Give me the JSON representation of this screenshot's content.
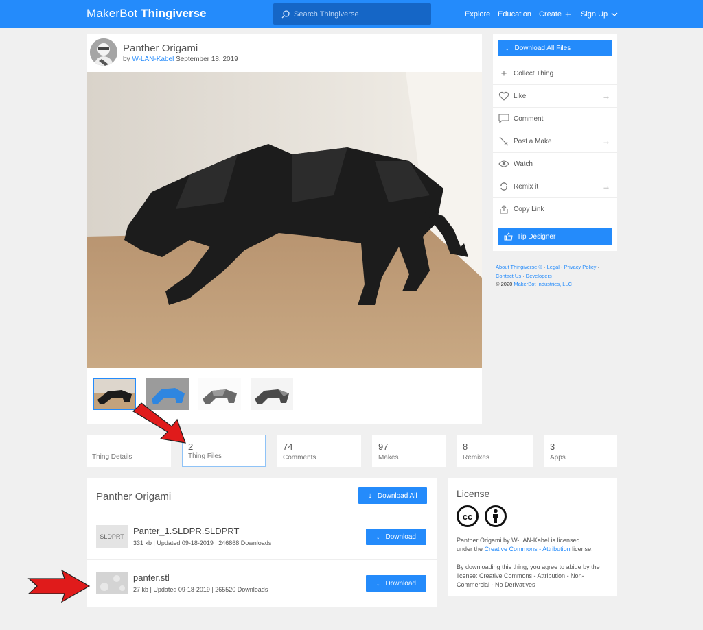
{
  "brand": {
    "part1": "MakerBot",
    "part2": "Thingiverse"
  },
  "search": {
    "placeholder": "Search Thingiverse"
  },
  "nav": {
    "explore": "Explore",
    "education": "Education",
    "create": "Create",
    "signup": "Sign Up"
  },
  "thing": {
    "title": "Panther Origami",
    "by_prefix": "by",
    "author": "W-LAN-Kabel",
    "date": "September 18, 2019",
    "thumbnails": [
      "black panther photo",
      "blue panther render",
      "grey panther render",
      "grey panther render dark"
    ]
  },
  "sidebar": {
    "download_all": "Download All Files",
    "actions": [
      {
        "label": "Collect Thing",
        "icon": "plus-icon",
        "arrow": false
      },
      {
        "label": "Like",
        "icon": "heart-icon",
        "arrow": true
      },
      {
        "label": "Comment",
        "icon": "comment-icon",
        "arrow": false
      },
      {
        "label": "Post a Make",
        "icon": "make-icon",
        "arrow": true
      },
      {
        "label": "Watch",
        "icon": "eye-icon",
        "arrow": false
      },
      {
        "label": "Remix it",
        "icon": "remix-icon",
        "arrow": true
      },
      {
        "label": "Copy Link",
        "icon": "share-icon",
        "arrow": false
      }
    ],
    "tip": "Tip Designer"
  },
  "footer": {
    "about": "About Thingiverse ®",
    "legal": "Legal",
    "privacy": "Privacy Policy",
    "contact": "Contact Us",
    "developers": "Developers",
    "copyright_prefix": "©  2020",
    "company": "MakerBot Industries, LLC"
  },
  "tabs": [
    {
      "count": "",
      "label": "Thing Details"
    },
    {
      "count": "2",
      "label": "Thing Files"
    },
    {
      "count": "74",
      "label": "Comments"
    },
    {
      "count": "97",
      "label": "Makes"
    },
    {
      "count": "8",
      "label": "Remixes"
    },
    {
      "count": "3",
      "label": "Apps"
    }
  ],
  "files": {
    "title": "Panther Origami",
    "download_all": "Download All",
    "download": "Download",
    "items": [
      {
        "thumb": "SLDPRT",
        "name": "Panter_1.SLDPR.SLDPRT",
        "meta": "331 kb | Updated 09-18-2019 | 246868 Downloads"
      },
      {
        "thumb": "",
        "name": "panter.stl",
        "meta": "27 kb | Updated 09-18-2019 | 265520 Downloads"
      }
    ]
  },
  "license": {
    "title": "License",
    "icon1": "cc",
    "line1_a": "Panther Origami by",
    "line1_author": "W-LAN-Kabel",
    "line1_b": "is licensed",
    "line2_a": "under the",
    "line2_link": "Creative Commons - Attribution",
    "line2_b": "license.",
    "agreement": "By downloading this thing, you agree to abide by the license: Creative Commons - Attribution - Non-Commercial - No Derivatives"
  },
  "colors": {
    "brand_blue": "#248bfb",
    "arrow_red": "#e01b1b",
    "search_bg": "#1566c6"
  }
}
